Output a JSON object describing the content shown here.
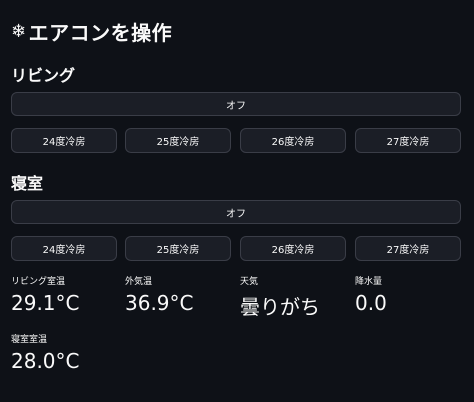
{
  "header": {
    "icon": "snowflake-icon",
    "title": "エアコンを操作"
  },
  "rooms": [
    {
      "name": "リビング",
      "off_label": "オフ",
      "temps": [
        "24度冷房",
        "25度冷房",
        "26度冷房",
        "27度冷房"
      ]
    },
    {
      "name": "寝室",
      "off_label": "オフ",
      "temps": [
        "24度冷房",
        "25度冷房",
        "26度冷房",
        "27度冷房"
      ]
    }
  ],
  "metrics": [
    {
      "label": "リビング室温",
      "value": "29.1°C"
    },
    {
      "label": "外気温",
      "value": "36.9°C"
    },
    {
      "label": "天気",
      "value": "曇りがち"
    },
    {
      "label": "降水量",
      "value": "0.0"
    },
    {
      "label": "寝室室温",
      "value": "28.0°C"
    }
  ]
}
